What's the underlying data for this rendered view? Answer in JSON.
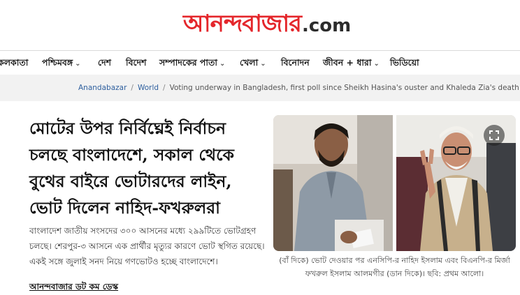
{
  "brand": {
    "name_bn": "আনন্দবাজার",
    "name_suffix": ".com"
  },
  "nav": {
    "items": [
      {
        "label": "কলকাতা",
        "has_menu": false
      },
      {
        "label": "পশ্চিমবঙ্গ",
        "has_menu": true
      },
      {
        "label": "দেশ",
        "has_menu": false
      },
      {
        "label": "বিদেশ",
        "has_menu": false
      },
      {
        "label": "সম্পাদকের পাতা",
        "has_menu": true
      },
      {
        "label": "খেলা",
        "has_menu": true
      },
      {
        "label": "বিনোদন",
        "has_menu": false
      },
      {
        "label": "জীবন + ধারা",
        "has_menu": true
      },
      {
        "label": "ভিডিয়ো",
        "has_menu": false
      }
    ]
  },
  "breadcrumb": {
    "items": [
      "Anandabazar",
      "World"
    ],
    "current": "Voting underway in Bangladesh, first poll since Sheikh Hasina's ouster and Khaleda Zia's death dgtl"
  },
  "article": {
    "headline": "মোটের উপর নির্বিঘ্নেই নির্বাচন চলছে বাংলাদেশে, সকাল থেকে বুথের বাইরে ভোটারদের লাইন, ভোট দিলেন নাহিদ-ফখরুলরা",
    "summary": "বাংলাদেশ জাতীয় সংসদের ৩০০ আসনের মধ্যে ২৯৯টিতে ভোটগ্রহণ চলছে। শেরপুর-৩ আসনে এক প্রার্থীর মৃত্যুর কারণে ভোট স্থগিত রয়েছে। একই সঙ্গে জুলাই সনদ নিয়ে গণভোটও হচ্ছে বাংলাদেশে।",
    "byline": "আনন্দবাজার ডট কম ডেস্ক",
    "image_caption": "(বাঁ দিকে) ভোট দেওয়ার পর এনসিপি-র নাহিদ ইসলাম এবং বিএনপি-র মির্জা ফখরুল ইসলাম আলমগীর (ডান দিকে)। ছবি: প্রথম আলো।"
  },
  "icons": {
    "expand": "fullscreen-expand-icon",
    "chevron": "chevron-down-icon"
  },
  "colors": {
    "brand_red": "#e4262b",
    "link_blue": "#2e5f9e"
  }
}
